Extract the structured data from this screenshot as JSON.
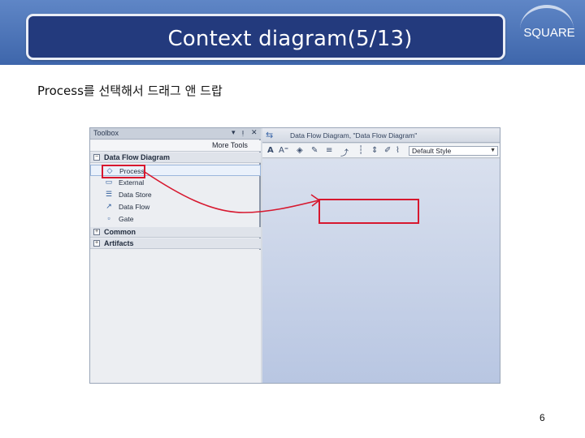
{
  "slide": {
    "title": "Context diagram(5/13)",
    "logo": "SQUARE",
    "subtitle": "Process를 선택해서 드래그 앤 드랍",
    "page_number": "6"
  },
  "toolbox": {
    "title": "Toolbox",
    "controls": [
      "▾",
      "ᴉ",
      "✕"
    ],
    "more_tools": "More Tools",
    "groups": [
      {
        "label": "Data Flow Diagram",
        "toggle": "−"
      },
      {
        "label": "Common",
        "toggle": "+"
      },
      {
        "label": "Artifacts",
        "toggle": "+"
      }
    ],
    "items": [
      {
        "label": "Process",
        "icon": "process-icon"
      },
      {
        "label": "External",
        "icon": "external-entity-icon"
      },
      {
        "label": "Data Store",
        "icon": "data-store-icon"
      },
      {
        "label": "Data Flow",
        "icon": "data-flow-icon"
      },
      {
        "label": "Gate",
        "icon": "gate-icon"
      }
    ]
  },
  "designer": {
    "tab_title": "Data Flow Diagram, \"Data Flow Diagram\"",
    "style_value": "Default Style"
  },
  "colors": {
    "header_band": "#4a72b6",
    "title_box": "#233a7d",
    "annotation": "#d7182f",
    "canvas": "#c6d2e8"
  }
}
